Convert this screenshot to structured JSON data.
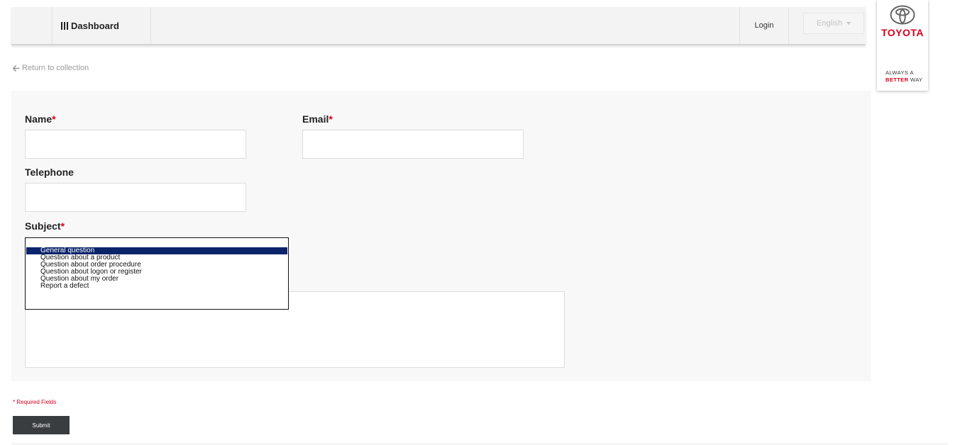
{
  "nav": {
    "dashboard_label": "Dashboard",
    "login_label": "Login",
    "language_label": "English"
  },
  "brand": {
    "name": "TOYOTA",
    "tagline_line1": "ALWAYS A",
    "tagline_better": "BETTER",
    "tagline_way": "WAY",
    "color": "#d6001c"
  },
  "back_link": "Return to collection",
  "form": {
    "name_label": "Name",
    "email_label": "Email",
    "telephone_label": "Telephone",
    "subject_label": "Subject",
    "required_marker": "*",
    "name_value": "",
    "email_value": "",
    "telephone_value": "",
    "message_value": "",
    "subject_options": [
      "General question",
      "Question about a product",
      "Question about order procedure",
      "Question about logon or register",
      "Question about my order",
      "Report a defect"
    ],
    "subject_selected": "General question",
    "required_note": "* Required Fields",
    "submit_label": "Submit"
  },
  "colors": {
    "accent": "#d6001c",
    "button": "#3a3d40",
    "selection": "#0a246a"
  }
}
